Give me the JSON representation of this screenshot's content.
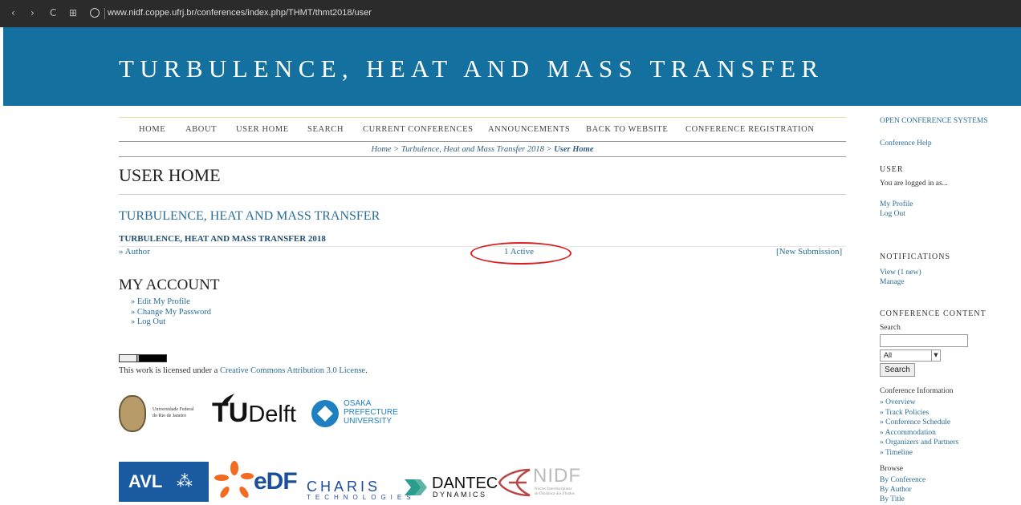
{
  "browser": {
    "url": "www.nidf.coppe.ufrj.br/conferences/index.php/THMT/thmt2018/user",
    "back_glyph": "‹",
    "forward_glyph": "›",
    "reload_glyph": "C",
    "apps_glyph": "⊞"
  },
  "banner": {
    "title": "TURBULENCE, HEAT AND MASS TRANSFER"
  },
  "nav": {
    "items": [
      "HOME",
      "ABOUT",
      "USER HOME",
      "SEARCH",
      "CURRENT CONFERENCES",
      "ANNOUNCEMENTS",
      "BACK TO WEBSITE",
      "CONFERENCE REGISTRATION"
    ]
  },
  "breadcrumb": {
    "home": "Home",
    "sep1": " > ",
    "conference": "Turbulence, Heat and Mass Transfer 2018",
    "sep2": " > ",
    "current": "User Home"
  },
  "main": {
    "page_title": "USER HOME",
    "conference_title": "TURBULENCE, HEAT AND MASS TRANSFER",
    "schedule_title": "TURBULENCE, HEAT AND MASS TRANSFER 2018",
    "author_link": "» Author",
    "active_link": "1 Active",
    "new_submission": "[New Submission]",
    "account_title": "MY ACCOUNT",
    "account_links": [
      "» Edit My Profile",
      "» Change My Password",
      "» Log Out"
    ],
    "license_prefix": "This work is licensed under a ",
    "license_link": "Creative Commons Attribution 3.0 License",
    "license_suffix": "."
  },
  "logos": {
    "ufrj_line1": "Universidade Federal",
    "ufrj_line2": "do Rio de Janeiro",
    "tudelft_tu": "TU",
    "tudelft_delft": "Delft",
    "osaka_line1": "OSAKA",
    "osaka_line2": "PREFECTURE",
    "osaka_line3": "UNIVERSITY",
    "avl": "AVL",
    "avl_mark": "⁂",
    "edf": "eDF",
    "charis": "CHARIS",
    "charis_sub": "TECHNOLOGIES",
    "dantec": "DANTEC",
    "dantec_sub": "DYNAMICS",
    "nidf": "NIDF",
    "nidf_sub1": "Núcleo Interdisciplinar",
    "nidf_sub2": "de Dinâmica dos Fluidos"
  },
  "sidebar": {
    "ocs_title": "OPEN CONFERENCE SYSTEMS",
    "conference_help": "Conference Help",
    "user_heading": "USER",
    "logged_in_as": "You are logged in as...",
    "my_profile": "My Profile",
    "log_out": "Log Out",
    "notifications_heading": "NOTIFICATIONS",
    "notif_view": "View (1 new)",
    "notif_manage": "Manage",
    "content_heading": "CONFERENCE CONTENT",
    "search_label": "Search",
    "search_value": "",
    "search_scope": "All",
    "search_button": "Search",
    "conf_info_label": "Conference Information",
    "conf_info_links": [
      "» Overview",
      "» Track Policies",
      "» Conference Schedule",
      "» Accommodation",
      "» Organizers and Partners",
      "» Timeline"
    ],
    "browse_label": "Browse",
    "browse_links": [
      "By Conference",
      "By Author",
      "By Title"
    ]
  },
  "colors": {
    "banner": "#13709f",
    "link": "#2a6d96",
    "highlight_ellipse": "#d92020"
  }
}
